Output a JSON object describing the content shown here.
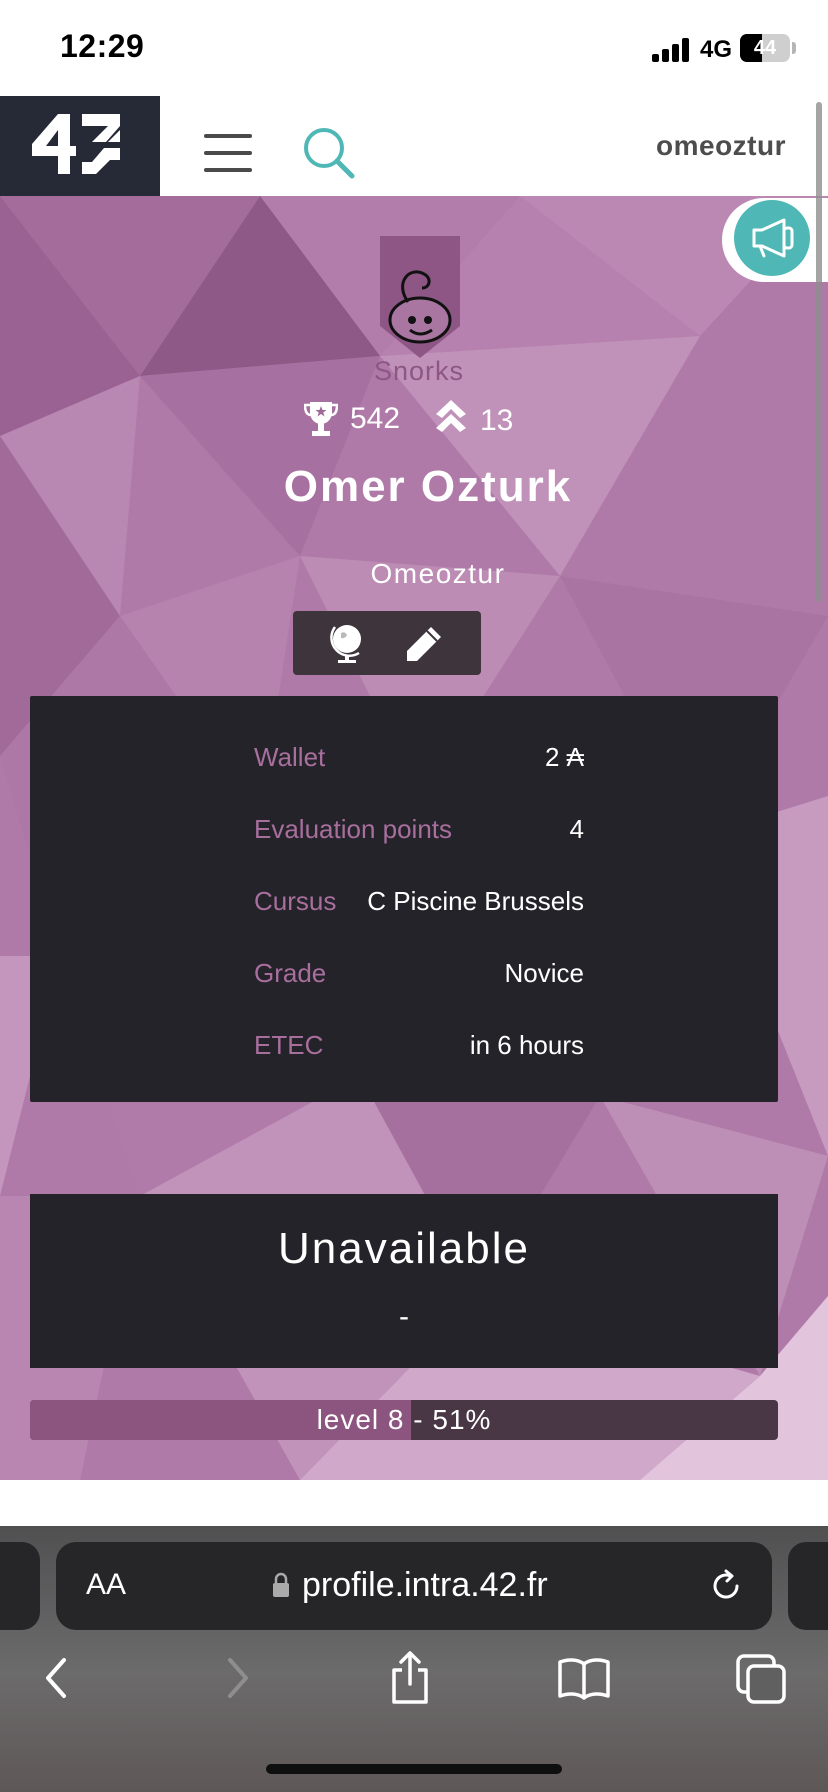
{
  "status_bar": {
    "time": "12:29",
    "network": "4G",
    "battery": "44",
    "battery_level": 0.44
  },
  "header": {
    "logo_alt": "42",
    "username": "omeoztur"
  },
  "profile": {
    "coalition": "Snorks",
    "coalition_color": "#8d5685",
    "points": "542",
    "rank": "13",
    "full_name": "Omer Ozturk",
    "login": "Omeoztur"
  },
  "info": {
    "rows": [
      {
        "label": "Wallet",
        "value": "2 ₳"
      },
      {
        "label": "Evaluation points",
        "value": "4"
      },
      {
        "label": "Cursus",
        "value": "C Piscine Brussels"
      },
      {
        "label": "Grade",
        "value": "Novice"
      },
      {
        "label": "ETEC",
        "value": "in 6 hours"
      }
    ]
  },
  "availability": {
    "title": "Unavailable",
    "sub": "-"
  },
  "level": {
    "text": "level 8 - 51%",
    "progress": 0.51
  },
  "browser": {
    "aa_label": "AA",
    "url": "profile.intra.42.fr"
  },
  "colors": {
    "accent_teal": "#4fb8b6",
    "panel_dark": "#24232a",
    "label_purple": "#a86f9d",
    "brand_dark": "#262a36"
  },
  "icons": [
    "trophy-icon",
    "rank-chevron-icon",
    "globe-icon",
    "pencil-icon",
    "megaphone-icon",
    "search-icon",
    "hamburger-icon",
    "lock-icon",
    "reload-icon",
    "back-icon",
    "forward-icon",
    "share-icon",
    "bookmarks-icon",
    "tabs-icon"
  ]
}
